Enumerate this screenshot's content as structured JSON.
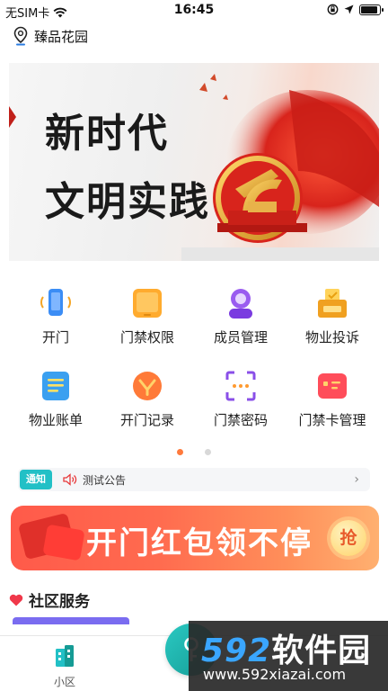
{
  "status_bar": {
    "carrier": "无SIM卡",
    "time": "16:45",
    "battery_level": 0.9
  },
  "location": {
    "name": "臻品花园"
  },
  "banner": {
    "line1": "新时代",
    "line2": "文明实践"
  },
  "menu": [
    {
      "label": "开门",
      "icon": "phone-icon"
    },
    {
      "label": "门禁权限",
      "icon": "tablet-icon"
    },
    {
      "label": "成员管理",
      "icon": "member-icon"
    },
    {
      "label": "物业投诉",
      "icon": "vote-box-icon"
    },
    {
      "label": "物业账单",
      "icon": "bill-icon"
    },
    {
      "label": "开门记录",
      "icon": "record-icon"
    },
    {
      "label": "门禁密码",
      "icon": "password-scan-icon"
    },
    {
      "label": "门禁卡管理",
      "icon": "card-icon"
    }
  ],
  "pager": {
    "pages": 2,
    "active": 0
  },
  "notice": {
    "tag": "通知",
    "text": "测试公告"
  },
  "promo": {
    "text": "开门红包领不停",
    "grab": "抢"
  },
  "section": {
    "title": "社区服务"
  },
  "tabbar": {
    "home_label": "小区"
  },
  "watermark": {
    "brand_num": "592",
    "brand_cn": "软件园",
    "url": "www.592xiazai.com"
  },
  "colors": {
    "accent": "#22c0c6",
    "promo": "#ff6b4f",
    "pager_active": "#ff7a3c"
  }
}
